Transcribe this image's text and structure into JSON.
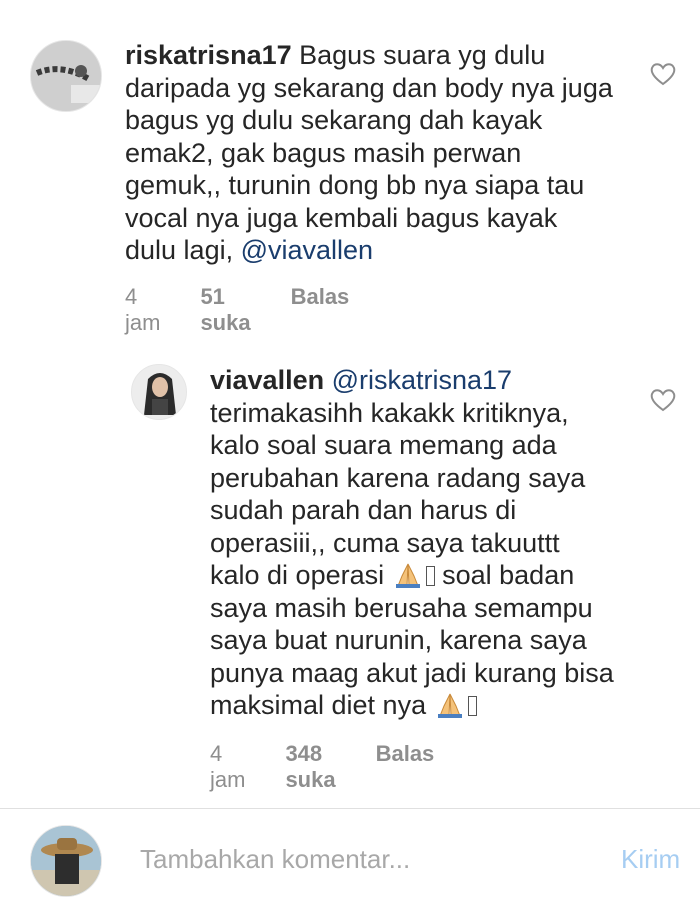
{
  "comments": [
    {
      "username": "riskatrisna17",
      "lines": [
        " Bagus suara yg dulu",
        "daripada yg sekarang dan body nya juga",
        "bagus yg dulu sekarang dah kayak",
        "emak2, gak bagus masih perwan",
        "gemuk,, turunin dong bb nya siapa tau",
        "vocal nya juga kembali bagus kayak",
        "dulu lagi, "
      ],
      "mention": "@viavallen",
      "time": "4 jam",
      "likes": "51 suka",
      "reply": "Balas",
      "like_icon": "heart-outline-icon"
    },
    {
      "username": "viavallen",
      "mention": "@riskatrisna17",
      "lines": [
        "terimakasihh kakakk kritiknya,",
        "kalo soal suara memang ada",
        "perubahan karena radang saya",
        "sudah parah dan harus di",
        "operasiii,, cuma saya takuuttt",
        "kalo di operasi ",
        " soal badan",
        "saya masih berusaha semampu",
        "saya buat nurunin, karena saya",
        "punya maag akut jadi kurang bisa",
        "maksimal diet nya "
      ],
      "time": "4 jam",
      "likes": "348 suka",
      "reply": "Balas",
      "like_icon": "heart-outline-icon",
      "emoji": "folded-hands-emoji"
    }
  ],
  "composer": {
    "placeholder": "Tambahkan komentar...",
    "send_label": "Kirim"
  },
  "colors": {
    "mention": "#1a3d6d",
    "meta": "#8e8e8e",
    "send_disabled": "#a6cdf2"
  }
}
